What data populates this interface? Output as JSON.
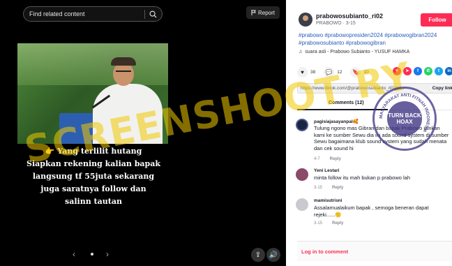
{
  "player": {
    "search_placeholder": "Find related content",
    "report_label": "Report",
    "caption": "👉 Yang terlilit hutang Siapkan rekening kalian bapak langsung tf 55juta sekarang juga saratnya follow dan salinn tautan"
  },
  "account": {
    "name": "prabowosubianto_ri02",
    "subline": "PRABOWO · 3-15",
    "follow_label": "Follow",
    "hashtags": "#prabowo #prabowopresiden2024 #prabowogibran2024 #prabowosubianto #prabowogibran",
    "music": "suara asli - Prabowo Subianto - YUSUF HAMKA"
  },
  "stats": {
    "likes": "38",
    "comments": "12",
    "saves": "10"
  },
  "share": {
    "link": "https://www.tiktok.com/@prabowosubianto_ri02/vi...",
    "copy_label": "Copy link"
  },
  "tabs": {
    "comments_label": "Comments (12)"
  },
  "comments": [
    {
      "name": "pagisiajasayanpal🥰",
      "text": "Tulung ngono mas Gibran dan bapak Prabowo izinkan kami ke sumber Sewu dia ini ada sound system di sumber Sewu bagaimana klub sound system yang sudah menata dan cek sound hi",
      "date": "4-7",
      "reply": "Reply",
      "likes": "0"
    },
    {
      "name": "Yeni Lestari",
      "text": "minta follow itu mah bukan p prabowo lah",
      "date": "3-15",
      "reply": "Reply",
      "likes": "1"
    },
    {
      "name": "mamisutrisni",
      "text": "Assalamualaikum bapak , semoga beneran dapat rejeki......🙂",
      "date": "3-15",
      "reply": "Reply",
      "likes": "1"
    }
  ],
  "login_label": "Log in to comment",
  "overlays": {
    "watermark": "SCREENSHOOT RY",
    "seal_center": "TURN BACK HOAX",
    "seal_ring": "MASYARAKAT ANTI FITNAH INDONESIA"
  },
  "colors": {
    "accent": "#fe2c55",
    "link": "#2b5db9",
    "player_bg": "#000000"
  }
}
